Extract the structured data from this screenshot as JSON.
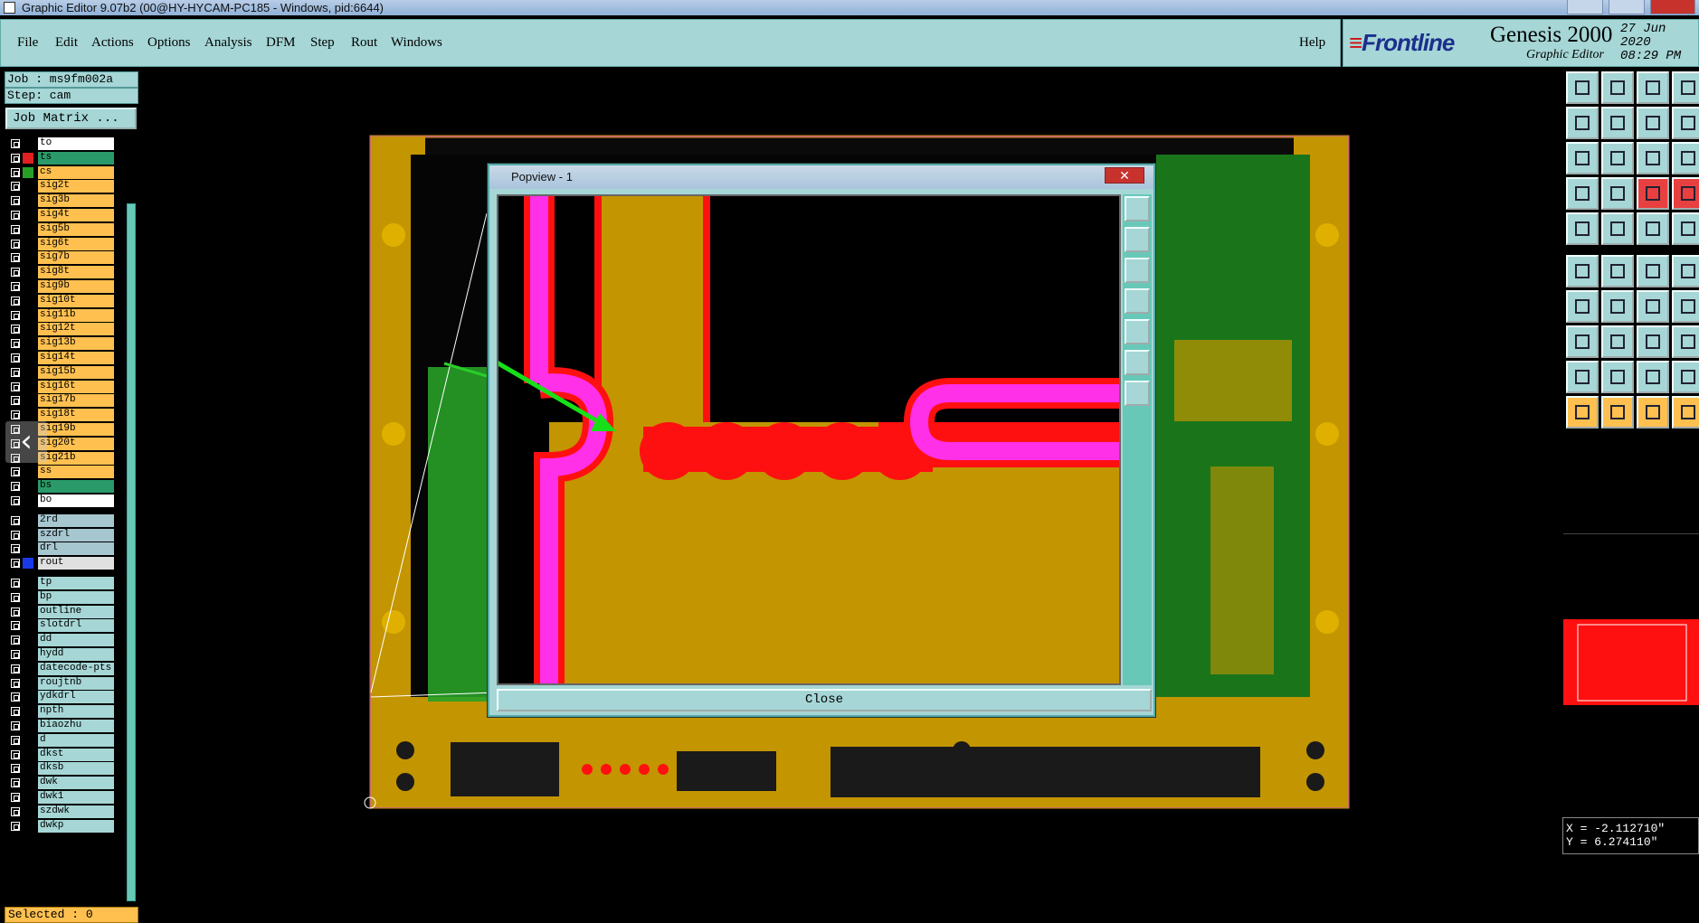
{
  "window": {
    "title": "Graphic Editor 9.07b2 (00@HY-HYCAM-PC185 - Windows, pid:6644)"
  },
  "menu": {
    "items": [
      "File",
      "Edit",
      "Actions",
      "Options",
      "Analysis",
      "DFM",
      "Step",
      "Rout",
      "Windows"
    ],
    "help": "Help"
  },
  "brand": {
    "logo": "Frontline",
    "product": "Genesis 2000",
    "subtitle": "Graphic Editor",
    "date": "27 Jun 2020",
    "time": "08:29 PM"
  },
  "job": {
    "job_label": "Job : ms9fm002a",
    "step_label": "Step: cam",
    "matrix_button": "Job Matrix ..."
  },
  "layers_group1": [
    {
      "name": "to",
      "color": "#ffffff",
      "swatch": "#000000"
    },
    {
      "name": "ts",
      "color": "#2a9a6a",
      "swatch": "#e02020"
    },
    {
      "name": "cs",
      "color": "#ffc050",
      "swatch": "#28a028"
    },
    {
      "name": "sig2t",
      "color": "#ffc050",
      "swatch": "#000000"
    },
    {
      "name": "sig3b",
      "color": "#ffc050",
      "swatch": "#000000"
    },
    {
      "name": "sig4t",
      "color": "#ffc050",
      "swatch": "#000000"
    },
    {
      "name": "sig5b",
      "color": "#ffc050",
      "swatch": "#000000"
    },
    {
      "name": "sig6t",
      "color": "#ffc050",
      "swatch": "#000000"
    },
    {
      "name": "sig7b",
      "color": "#ffc050",
      "swatch": "#000000"
    },
    {
      "name": "sig8t",
      "color": "#ffc050",
      "swatch": "#000000"
    },
    {
      "name": "sig9b",
      "color": "#ffc050",
      "swatch": "#000000"
    },
    {
      "name": "sig10t",
      "color": "#ffc050",
      "swatch": "#000000"
    },
    {
      "name": "sig11b",
      "color": "#ffc050",
      "swatch": "#000000"
    },
    {
      "name": "sig12t",
      "color": "#ffc050",
      "swatch": "#000000"
    },
    {
      "name": "sig13b",
      "color": "#ffc050",
      "swatch": "#000000"
    },
    {
      "name": "sig14t",
      "color": "#ffc050",
      "swatch": "#000000"
    },
    {
      "name": "sig15b",
      "color": "#ffc050",
      "swatch": "#000000"
    },
    {
      "name": "sig16t",
      "color": "#ffc050",
      "swatch": "#000000"
    },
    {
      "name": "sig17b",
      "color": "#ffc050",
      "swatch": "#000000"
    },
    {
      "name": "sig18t",
      "color": "#ffc050",
      "swatch": "#000000"
    },
    {
      "name": "sig19b",
      "color": "#ffc050",
      "swatch": "#000000"
    },
    {
      "name": "sig20t",
      "color": "#ffc050",
      "swatch": "#000000"
    },
    {
      "name": "sig21b",
      "color": "#ffc050",
      "swatch": "#000000"
    },
    {
      "name": "ss",
      "color": "#ffc050",
      "swatch": "#000000"
    },
    {
      "name": "bs",
      "color": "#2a9a6a",
      "swatch": "#000000"
    },
    {
      "name": "bo",
      "color": "#ffffff",
      "swatch": "#000000"
    }
  ],
  "layers_group2": [
    {
      "name": "2rd",
      "color": "#a6c6d0",
      "swatch": "#000000"
    },
    {
      "name": "szdrl",
      "color": "#a6c6d0",
      "swatch": "#000000"
    },
    {
      "name": "drl",
      "color": "#a6c6d0",
      "swatch": "#000000"
    },
    {
      "name": "rout",
      "color": "#e0e0e0",
      "swatch": "#1a3ae8"
    }
  ],
  "layers_group3": [
    {
      "name": "tp"
    },
    {
      "name": "bp"
    },
    {
      "name": "outline"
    },
    {
      "name": "slotdrl"
    },
    {
      "name": "dd"
    },
    {
      "name": "hydd"
    },
    {
      "name": "datecode-pts"
    },
    {
      "name": "roujtnb"
    },
    {
      "name": "ydkdrl"
    },
    {
      "name": "npth"
    },
    {
      "name": "biaozhu"
    },
    {
      "name": "d"
    },
    {
      "name": "dkst"
    },
    {
      "name": "dksb"
    },
    {
      "name": "dwk"
    },
    {
      "name": "dwk1"
    },
    {
      "name": "szdwk"
    },
    {
      "name": "dwkp"
    }
  ],
  "status": {
    "selected": "Selected : 0"
  },
  "popview": {
    "title": "Popview - 1",
    "close_x": "✕",
    "close_button": "Close"
  },
  "coords": {
    "x": "X = -2.112710\"",
    "y": "Y = 6.274110\""
  },
  "colors": {
    "panel": "#a6d6d6",
    "copper": "#c39500",
    "green": "#28a028",
    "red": "#ff1010",
    "magenta": "#ff30e8"
  }
}
